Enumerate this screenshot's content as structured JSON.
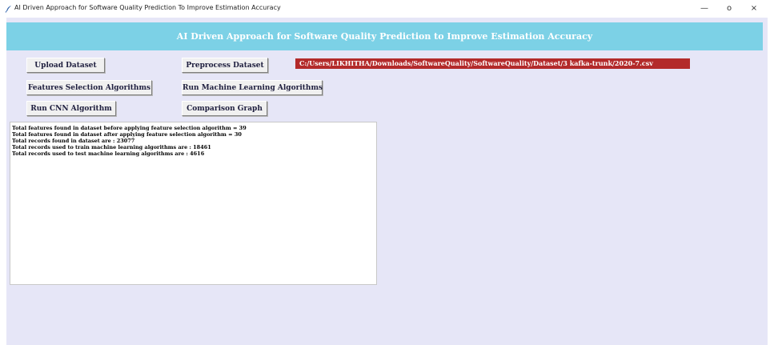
{
  "window": {
    "title": "AI Driven Approach for Software Quality Prediction To Improve Estimation Accuracy",
    "minimize": "—",
    "maximize": "o",
    "close": "×"
  },
  "header": {
    "title": "AI Driven Approach for Software Quality Prediction to Improve Estimation Accuracy",
    "background": "#7cd1e6"
  },
  "buttons": {
    "upload": "Upload Dataset",
    "preprocess": "Preprocess Dataset",
    "feature_selection": "Features Selection Algorithms",
    "run_ml": "Run Machine Learning Algorithms",
    "run_cnn": "Run CNN Algorithm",
    "comparison": "Comparison Graph"
  },
  "dataset_path": "C:/Users/LIKHITHA/Downloads/SoftwareQuality/SoftwareQuality/Dataset/3 kafka-trunk/2020-7.csv",
  "output": {
    "lines": [
      "Total features found in dataset before applying feature selection algorithm = 39",
      "Total features found in dataset after applying feature selection algorithm  = 30",
      "Total records found in dataset are : 23077",
      "Total records used to train machine learning algorithms are : 18461",
      "Total records used to test machine learning algorithms are  : 4616"
    ]
  },
  "colors": {
    "client_bg": "#e6e6f7",
    "path_bg": "#b32a2a"
  }
}
